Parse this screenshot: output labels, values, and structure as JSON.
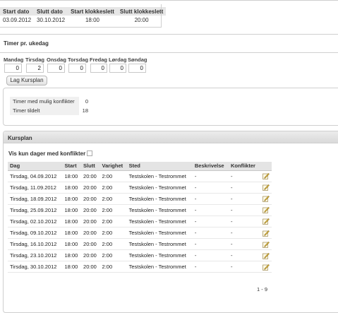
{
  "schedule": {
    "headers": [
      "Start dato",
      "Slutt dato",
      "Start klokkeslett",
      "Slutt klokkeslett"
    ],
    "row": [
      "03.09.2012",
      "30.10.2012",
      "18:00",
      "20:00"
    ]
  },
  "weekly": {
    "title": "Timer pr. ukedag",
    "days": [
      {
        "label": "Mandag",
        "value": "0"
      },
      {
        "label": "Tirsdag",
        "value": "2"
      },
      {
        "label": "Onsdag",
        "value": "0"
      },
      {
        "label": "Torsdag",
        "value": "0"
      },
      {
        "label": "Fredag",
        "value": "0"
      },
      {
        "label": "Lørdag",
        "value": "0"
      },
      {
        "label": "Søndag",
        "value": "0"
      }
    ],
    "button": "Lag Kursplan"
  },
  "stats": {
    "rows": [
      {
        "label": "Timer med mulig konflikter",
        "value": "0"
      },
      {
        "label": "Timer tildelt",
        "value": "18"
      }
    ]
  },
  "kursplan": {
    "title": "Kursplan",
    "filter_label": "Vis kun dager med konflikter",
    "columns": [
      "Dag",
      "Start",
      "Slutt",
      "Varighet",
      "Sted",
      "Beskrivelse",
      "Konflikter"
    ],
    "rows": [
      [
        "Tirsdag, 04.09.2012",
        "18:00",
        "20:00",
        "2:00",
        "Testskolen - Testrommet",
        "-",
        "-"
      ],
      [
        "Tirsdag, 11.09.2012",
        "18:00",
        "20:00",
        "2:00",
        "Testskolen - Testrommet",
        "-",
        "-"
      ],
      [
        "Tirsdag, 18.09.2012",
        "18:00",
        "20:00",
        "2:00",
        "Testskolen - Testrommet",
        "-",
        "-"
      ],
      [
        "Tirsdag, 25.09.2012",
        "18:00",
        "20:00",
        "2:00",
        "Testskolen - Testrommet",
        "-",
        "-"
      ],
      [
        "Tirsdag, 02.10.2012",
        "18:00",
        "20:00",
        "2:00",
        "Testskolen - Testrommet",
        "-",
        "-"
      ],
      [
        "Tirsdag, 09.10.2012",
        "18:00",
        "20:00",
        "2:00",
        "Testskolen - Testrommet",
        "-",
        "-"
      ],
      [
        "Tirsdag, 16.10.2012",
        "18:00",
        "20:00",
        "2:00",
        "Testskolen - Testrommet",
        "-",
        "-"
      ],
      [
        "Tirsdag, 23.10.2012",
        "18:00",
        "20:00",
        "2:00",
        "Testskolen - Testrommet",
        "-",
        "-"
      ],
      [
        "Tirsdag, 30.10.2012",
        "18:00",
        "20:00",
        "2:00",
        "Testskolen - Testrommet",
        "-",
        "-"
      ]
    ],
    "pager": "1 - 9",
    "row_icon": "edit-icon"
  }
}
